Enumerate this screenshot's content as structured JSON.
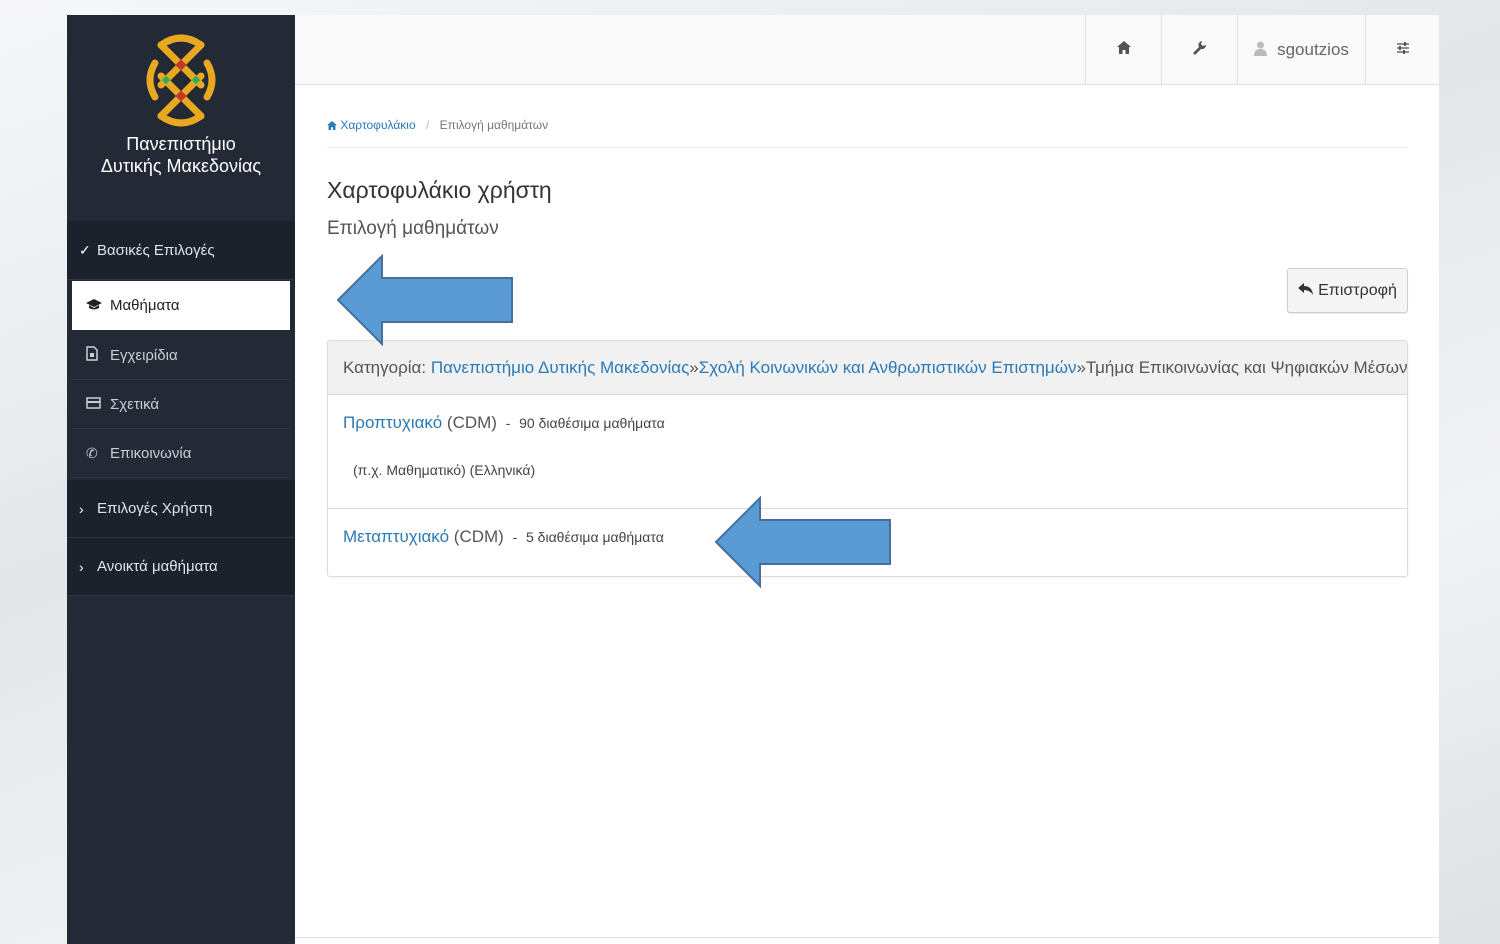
{
  "sidebar": {
    "university_name_line1": "Πανεπιστήμιο",
    "university_name_line2": "Δυτικής Μακεδονίας",
    "sections": [
      {
        "label": "Βασικές Επιλογές",
        "expanded": true
      },
      {
        "label": "Επιλογές Χρήστη",
        "expanded": false
      },
      {
        "label": "Ανοικτά μαθήματα",
        "expanded": false
      }
    ],
    "items": [
      {
        "label": "Μαθήματα",
        "icon": "graduation-cap-icon",
        "active": true
      },
      {
        "label": "Εγχειρίδια",
        "icon": "document-icon",
        "active": false
      },
      {
        "label": "Σχετικά",
        "icon": "card-icon",
        "active": false
      },
      {
        "label": "Επικοινωνία",
        "icon": "phone-icon",
        "active": false
      }
    ]
  },
  "topbar": {
    "home_icon": "home-icon",
    "tools_icon": "wrench-icon",
    "username": "sgoutzios",
    "settings_icon": "sliders-icon"
  },
  "breadcrumb": {
    "root": "Χαρτοφυλάκιο",
    "current": "Επιλογή μαθημάτων"
  },
  "page": {
    "title": "Χαρτοφυλάκιο χρήστη",
    "subtitle": "Επιλογή μαθημάτων",
    "back_label": "Επιστροφή"
  },
  "category": {
    "prefix": "Κατηγορία:",
    "level1": "Πανεπιστήμιο Δυτικής Μακεδονίας",
    "sep1": " » ",
    "level2": "Σχολή Κοινωνικών και Ανθρωπιστικών Επιστημών",
    "sep2": " » ",
    "level3": "Τμήμα Επικοινωνίας και Ψηφιακών Μέσων"
  },
  "courses": [
    {
      "name": "Προπτυχιακό",
      "code": "(CDM)",
      "dash": "-",
      "count": "90 διαθέσιμα μαθήματα",
      "note": "(π.χ. Μαθηματικό) (Ελληνικά)"
    },
    {
      "name": "Μεταπτυχιακό",
      "code": "(CDM)",
      "dash": "-",
      "count": "5 διαθέσιμα μαθήματα"
    }
  ],
  "colors": {
    "sidebar_bg": "#232a36",
    "link": "#2a7ab8",
    "arrow_fill": "#5b9bd5",
    "arrow_stroke": "#41719c"
  }
}
